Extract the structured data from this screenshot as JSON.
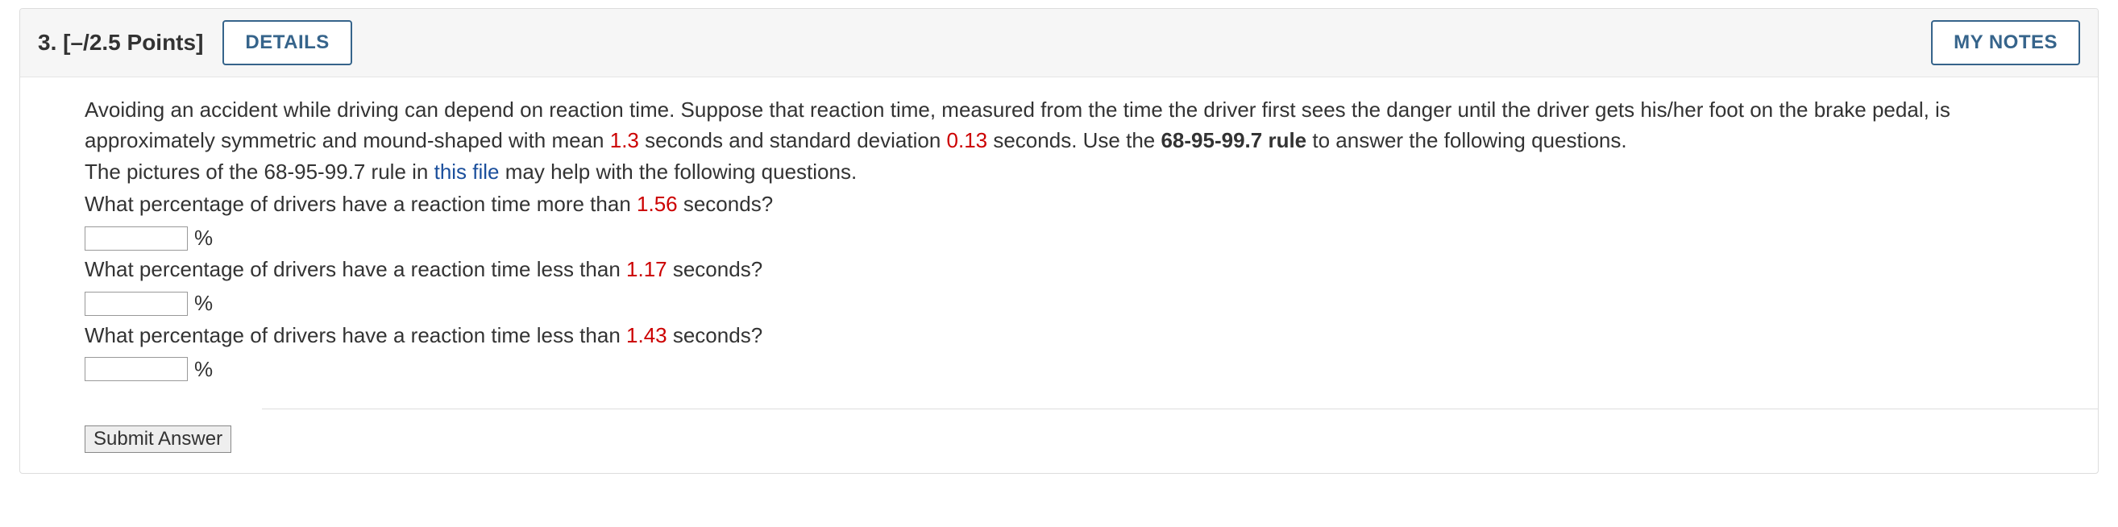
{
  "header": {
    "number_label": "3.",
    "points_label": "[–/2.5 Points]",
    "details_label": "DETAILS",
    "my_notes_label": "MY NOTES"
  },
  "body": {
    "intro_pre": "Avoiding an accident while driving can depend on reaction time. Suppose that reaction time, measured from the time the driver first sees the danger until the driver gets his/her foot on the brake pedal, is approximately symmetric and mound-shaped with mean ",
    "mean_value": "1.3",
    "intro_mid1": " seconds and standard deviation ",
    "sd_value": "0.13",
    "intro_mid2": " seconds. Use the ",
    "rule_bold": "68-95-99.7 rule",
    "intro_post": " to answer the following questions.",
    "file_line_pre": "The pictures of the 68-95-99.7 rule in ",
    "file_link_text": "this file",
    "file_line_post": " may help with the following questions.",
    "q1_pre": "What percentage of drivers have a reaction time more than ",
    "q1_value": "1.56",
    "q1_post": " seconds?",
    "q2_pre": "What percentage of drivers have a reaction time less than ",
    "q2_value": "1.17",
    "q2_post": " seconds?",
    "q3_pre": "What percentage of drivers have a reaction time less than ",
    "q3_value": "1.43",
    "q3_post": " seconds?",
    "percent_symbol": "%",
    "submit_label": "Submit Answer"
  }
}
